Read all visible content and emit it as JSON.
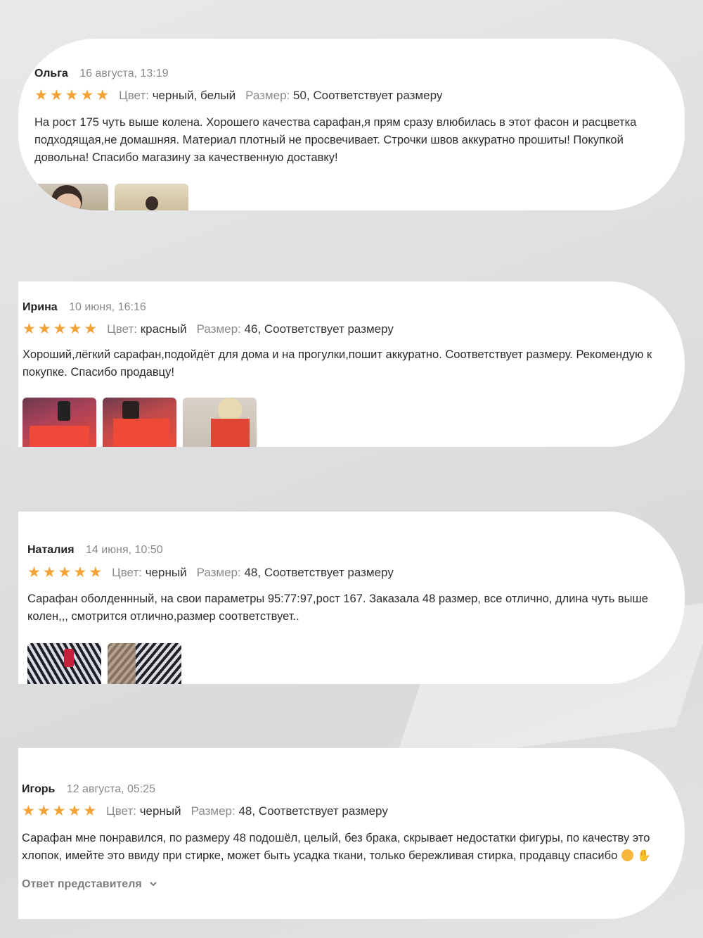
{
  "reviews": [
    {
      "author": "Ольга",
      "date": "16 августа, 13:19",
      "rating": 5,
      "color_label": "Цвет:",
      "color_value": "черный, белый",
      "size_label": "Размер:",
      "size_value": "50, Соответствует размеру",
      "text": "На рост 175 чуть выше колена. Хорошего качества сарафан,я прям сразу влюбилась в этот фасон и расцветка подходящая,не домашняя. Материал плотный не просвечивает. Строчки швов аккуратно прошиты! Покупкой довольна! Спасибо магазину за качественную доставку!",
      "photo_count": 2
    },
    {
      "author": "Ирина",
      "date": "10 июня, 16:16",
      "rating": 5,
      "color_label": "Цвет:",
      "color_value": "красный",
      "size_label": "Размер:",
      "size_value": "46, Соответствует размеру",
      "text": "Хороший,лёгкий сарафан,подойдёт для дома и на прогулки,пошит аккуратно. Соответствует размеру. Рекомендую к покупке. Спасибо продавцу!",
      "photo_count": 3
    },
    {
      "author": "Наталия",
      "date": "14 июня, 10:50",
      "rating": 5,
      "color_label": "Цвет:",
      "color_value": "черный",
      "size_label": "Размер:",
      "size_value": "48, Соответствует размеру",
      "text": "Сарафан оболденнный, на свои параметры 95:77:97,рост 167. Заказала 48 размер, все отлично, длина чуть выше колен,,, смотрится отлично,размер соответствует..",
      "photo_count": 2
    },
    {
      "author": "Игорь",
      "date": "12 августа, 05:25",
      "rating": 5,
      "color_label": "Цвет:",
      "color_value": "черный",
      "size_label": "Размер:",
      "size_value": "48, Соответствует размеру",
      "text": "Сарафан мне понравился, по размеру 48 подошёл, целый, без брака, скрывает недостатки фигуры, по качеству это хлопок, имейте это ввиду при стирке, может быть усадка ткани, только бережливая стирка, продавцу спасибо",
      "answer_label": "Ответ представителя"
    }
  ],
  "icons": {
    "star": "star-icon",
    "chevron": "chevron-down-icon",
    "emoji1": "hugging-face-emoji",
    "emoji2": "thumbs-up-emoji"
  },
  "colors": {
    "star": "#f4a236",
    "text": "#2b2b2b",
    "muted": "#8a8a8a"
  }
}
